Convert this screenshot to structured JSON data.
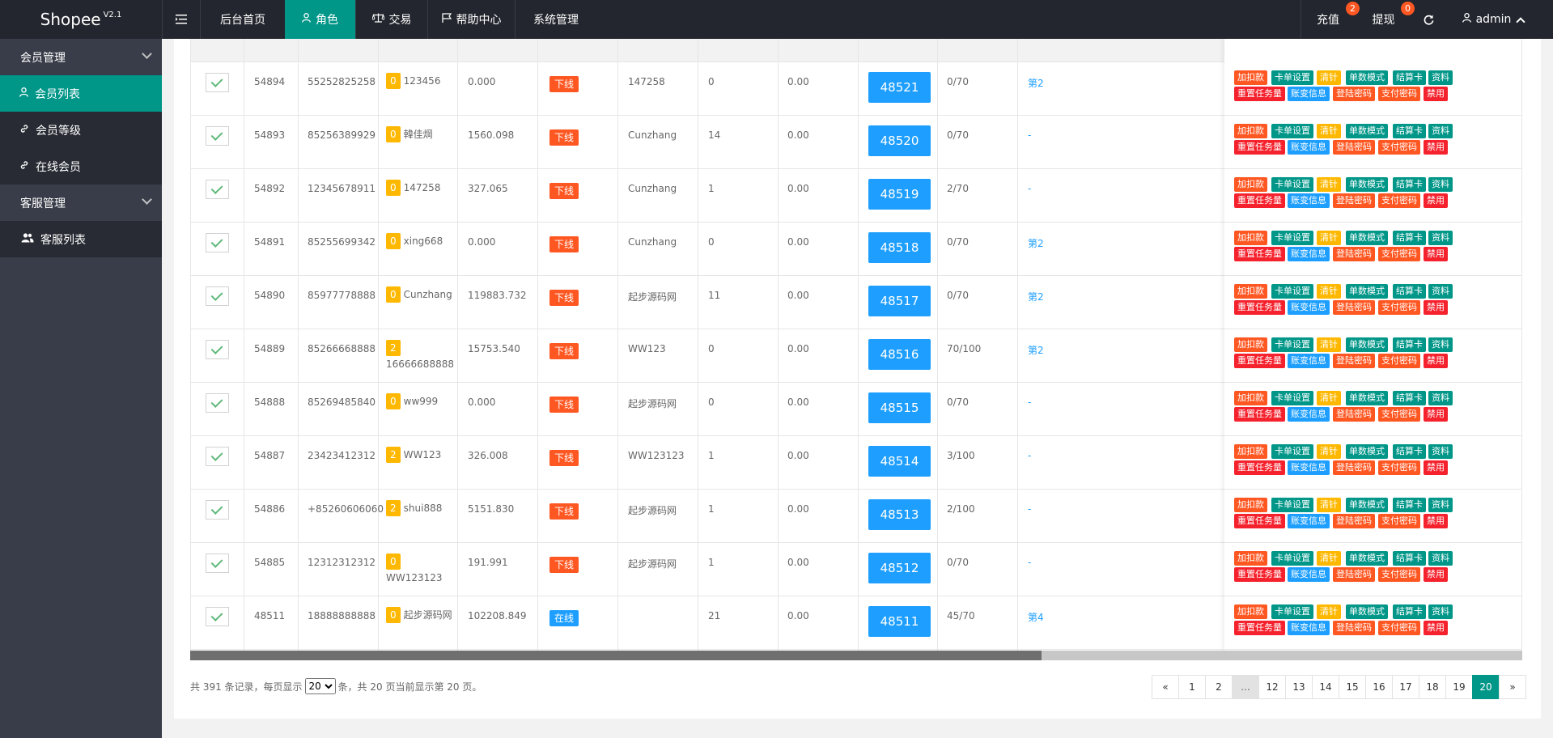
{
  "brand": {
    "name": "Shopee",
    "version": "V2.1"
  },
  "topnav": {
    "menu_icon": "menu-fold-icon",
    "items": [
      {
        "label": "后台首页",
        "icon": ""
      },
      {
        "label": "角色",
        "icon": "user-icon"
      },
      {
        "label": "交易",
        "icon": "scale-icon"
      },
      {
        "label": "帮助中心",
        "icon": "flag-icon"
      },
      {
        "label": "系统管理",
        "icon": ""
      }
    ],
    "active_index": 1,
    "recharge": {
      "label": "充值",
      "badge": "2"
    },
    "withdraw": {
      "label": "提现",
      "badge": "0"
    },
    "refresh_icon": "refresh-icon",
    "user": "admin"
  },
  "sidebar": {
    "groups": [
      {
        "label": "会员管理",
        "items": [
          {
            "label": "会员列表",
            "icon": "user-icon",
            "active": true
          },
          {
            "label": "会员等级",
            "icon": "link-icon"
          },
          {
            "label": "在线会员",
            "icon": "link-icon"
          }
        ]
      },
      {
        "label": "客服管理",
        "items": [
          {
            "label": "客服列表",
            "icon": "users-icon"
          }
        ]
      }
    ]
  },
  "rows": [
    {
      "id": "54894",
      "phone": "55252825258",
      "level": "0",
      "name": "123456",
      "balance": "0.000",
      "status": "下线",
      "parent": "147258",
      "count": "0",
      "frozen": "0.00",
      "code": "48521",
      "progress": "0/70",
      "extra": "第2"
    },
    {
      "id": "54893",
      "phone": "85256389929",
      "level": "0",
      "name": "韓佳焵",
      "balance": "1560.098",
      "status": "下线",
      "parent": "Cunzhang",
      "count": "14",
      "frozen": "0.00",
      "code": "48520",
      "progress": "0/70",
      "extra": "-"
    },
    {
      "id": "54892",
      "phone": "12345678911",
      "level": "0",
      "name": "147258",
      "balance": "327.065",
      "status": "下线",
      "parent": "Cunzhang",
      "count": "1",
      "frozen": "0.00",
      "code": "48519",
      "progress": "2/70",
      "extra": "-"
    },
    {
      "id": "54891",
      "phone": "85255699342",
      "level": "0",
      "name": "xing668",
      "balance": "0.000",
      "status": "下线",
      "parent": "Cunzhang",
      "count": "0",
      "frozen": "0.00",
      "code": "48518",
      "progress": "0/70",
      "extra": "第2"
    },
    {
      "id": "54890",
      "phone": "85977778888",
      "level": "0",
      "name": "Cunzhang",
      "balance": "119883.732",
      "status": "下线",
      "parent": "起步源码网",
      "count": "11",
      "frozen": "0.00",
      "code": "48517",
      "progress": "0/70",
      "extra": "第2"
    },
    {
      "id": "54889",
      "phone": "85266668888",
      "level": "2",
      "name": "16666688888",
      "balance": "15753.540",
      "status": "下线",
      "parent": "WW123",
      "count": "0",
      "frozen": "0.00",
      "code": "48516",
      "progress": "70/100",
      "extra": "第2"
    },
    {
      "id": "54888",
      "phone": "85269485840",
      "level": "0",
      "name": "ww999",
      "balance": "0.000",
      "status": "下线",
      "parent": "起步源码网",
      "count": "0",
      "frozen": "0.00",
      "code": "48515",
      "progress": "0/70",
      "extra": "-"
    },
    {
      "id": "54887",
      "phone": "23423412312",
      "level": "2",
      "name": "WW123",
      "balance": "326.008",
      "status": "下线",
      "parent": "WW123123",
      "count": "1",
      "frozen": "0.00",
      "code": "48514",
      "progress": "3/100",
      "extra": "-"
    },
    {
      "id": "54886",
      "phone": "+85260606060",
      "level": "2",
      "name": "shui888",
      "balance": "5151.830",
      "status": "下线",
      "parent": "起步源码网",
      "count": "1",
      "frozen": "0.00",
      "code": "48513",
      "progress": "2/100",
      "extra": "-"
    },
    {
      "id": "54885",
      "phone": "12312312312",
      "level": "0",
      "name": "WW123123",
      "balance": "191.991",
      "status": "下线",
      "parent": "起步源码网",
      "count": "1",
      "frozen": "0.00",
      "code": "48512",
      "progress": "0/70",
      "extra": "-"
    },
    {
      "id": "48511",
      "phone": "18888888888",
      "level": "0",
      "name": "起步源码网",
      "balance": "102208.849",
      "status": "在线",
      "parent": "",
      "count": "21",
      "frozen": "0.00",
      "code": "48511",
      "progress": "45/70",
      "extra": "第4"
    }
  ],
  "ops": {
    "row1": [
      {
        "label": "加扣款",
        "color": "#ff5722"
      },
      {
        "label": "卡单设置",
        "color": "#009688"
      },
      {
        "label": "清针",
        "color": "#ffb800"
      },
      {
        "label": "单数模式",
        "color": "#009688"
      },
      {
        "label": "结算卡",
        "color": "#009688"
      },
      {
        "label": "资料",
        "color": "#009688"
      }
    ],
    "row2": [
      {
        "label": "重置任务量",
        "color": "#f5222d"
      },
      {
        "label": "账变信息",
        "color": "#1e9fff"
      },
      {
        "label": "登陆密码",
        "color": "#ff5722"
      },
      {
        "label": "支付密码",
        "color": "#ff5722"
      },
      {
        "label": "禁用",
        "color": "#f5222d"
      }
    ]
  },
  "footer": {
    "pre": "共 391 条记录，每页显示",
    "per_page": "20",
    "post": "条，共 20 页当前显示第 20 页。"
  },
  "pager": [
    "«",
    "1",
    "2",
    "...",
    "12",
    "13",
    "14",
    "15",
    "16",
    "17",
    "18",
    "19",
    "20",
    "»"
  ],
  "pager_current": "20",
  "colors": {
    "online": "#1e9fff",
    "offline": "#ff5722",
    "primary": "#009688"
  }
}
